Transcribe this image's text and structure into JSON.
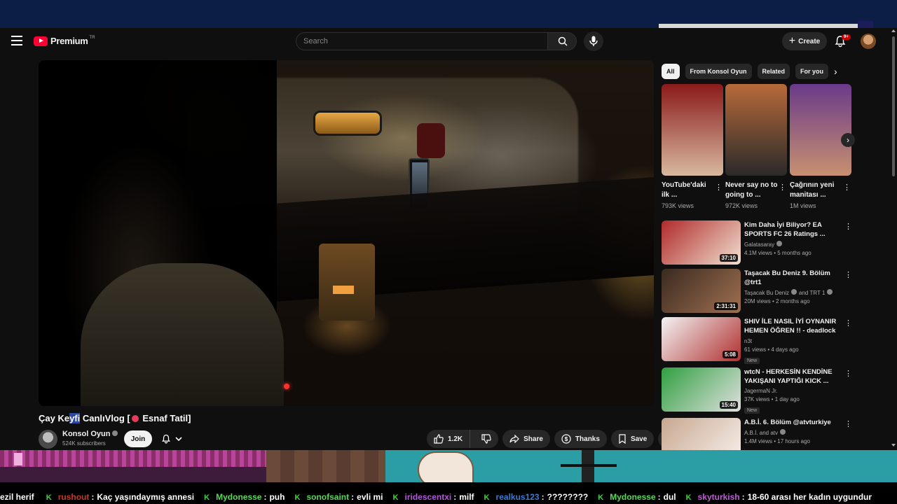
{
  "masthead": {
    "logo_text": "Premium",
    "region": "TR",
    "search_placeholder": "Search",
    "create_label": "Create",
    "notifications_badge": "9+"
  },
  "video": {
    "title_pre": "Çay Ke",
    "title_sel": "yfi",
    "title_mid": " CanlıVlog [",
    "title_post": " Esnaf Tatil]",
    "channel": "Konsol Oyun",
    "subscribers": "524K subscribers",
    "join_label": "Join",
    "likes": "1.2K",
    "share_label": "Share",
    "thanks_label": "Thanks",
    "save_label": "Save"
  },
  "chips": [
    "All",
    "From Konsol Oyun",
    "Related",
    "For you"
  ],
  "shorts": [
    {
      "title": "YouTube'daki ilk ...",
      "views": "793K views",
      "colors": [
        "#8a1a1a",
        "#d8b8a0"
      ]
    },
    {
      "title": "Never say no to going to ...",
      "views": "972K views",
      "colors": [
        "#b86a3a",
        "#2a2a2a"
      ]
    },
    {
      "title": "Çağrının yeni manitası ...",
      "views": "1M views",
      "colors": [
        "#6a3a8a",
        "#c89070"
      ]
    }
  ],
  "recommendations": [
    {
      "title": "Kim Daha İyi Biliyor? EA SPORTS FC 26 Ratings ...",
      "channel": "Galatasaray",
      "verified": true,
      "views": "4.1M views • 5 months ago",
      "duration": "37:10",
      "badge": "",
      "colors": [
        "#b02a2a",
        "#f0e0d0"
      ]
    },
    {
      "title": "Taşacak Bu Deniz 9. Bölüm @trt1",
      "channel": "Taşacak Bu Deniz",
      "verified": true,
      "channel_extra": "and TRT 1",
      "views": "20M views • 2 months ago",
      "duration": "2:31:31",
      "badge": "",
      "colors": [
        "#3a2a20",
        "#a07050"
      ]
    },
    {
      "title": "SHIV İLE NASIL İYİ OYNANIR HEMEN ÖĞREN !! - deadlock ...",
      "channel": "n3t",
      "verified": false,
      "views": "61 views • 4 days ago",
      "duration": "5:08",
      "badge": "New",
      "colors": [
        "#f4f4f4",
        "#b03030"
      ]
    },
    {
      "title": "wtcN - HERKESİN KENDİNE YAKIŞANI YAPTIĞI KICK ...",
      "channel": "JagermaN Jr.",
      "verified": false,
      "views": "37K views • 1 day ago",
      "duration": "15:40",
      "badge": "New",
      "colors": [
        "#30a040",
        "#e0e0e0"
      ]
    },
    {
      "title": "A.B.İ. 6. Bölüm @atvturkiye",
      "channel": "A.B.İ. and atv",
      "verified": true,
      "views": "1.4M views • 17 hours ago",
      "duration": "",
      "badge": "",
      "colors": [
        "#c8a890",
        "#f8f0ec"
      ]
    }
  ],
  "chat": [
    {
      "user": "ezil herif",
      "user_color": "#ffffff",
      "text": "",
      "lead": false
    },
    {
      "user": "rushout",
      "user_color": "#c0392b",
      "text": "Kaç yaşındaymış annesi",
      "lead": true
    },
    {
      "user": "Mydonesse",
      "user_color": "#5ad65a",
      "text": "puh",
      "lead": true
    },
    {
      "user": "sonofsaint",
      "user_color": "#5ad65a",
      "text": "evli mi",
      "lead": true
    },
    {
      "user": "iridescentxi",
      "user_color": "#b05ad6",
      "text": "milf",
      "lead": true
    },
    {
      "user": "realkus123",
      "user_color": "#3a7bd5",
      "text": "????????",
      "lead": true
    },
    {
      "user": "Mydonesse",
      "user_color": "#5ad65a",
      "text": "dul",
      "lead": true
    },
    {
      "user": "skyturkish",
      "user_color": "#c05ad6",
      "text": "18-60 arası her kadın uygundur",
      "lead": true
    }
  ]
}
